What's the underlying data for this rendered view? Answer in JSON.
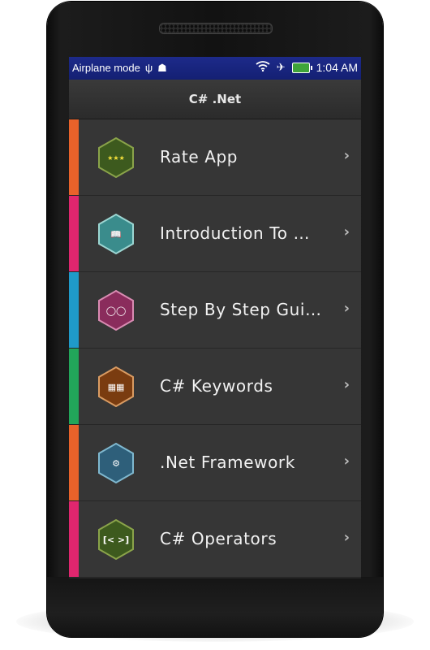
{
  "status_bar": {
    "left_text": "Airplane mode",
    "usb_icon": "usb-icon",
    "android_icon": "android-icon",
    "wifi_icon": "wifi-icon",
    "airplane_icon": "airplane-icon",
    "battery_icon": "battery-charging-icon",
    "time": "1:04 AM"
  },
  "app_bar": {
    "title": "C# .Net"
  },
  "menu": [
    {
      "label": "Rate App",
      "stripe_color": "#e8622a",
      "icon": "stars-icon",
      "icon_symbol": "★★★",
      "hex_color": "#3d5a1e",
      "hex_border": "#8aa34a"
    },
    {
      "label": "Introduction To …",
      "stripe_color": "#e0266e",
      "icon": "book-icon",
      "icon_symbol": "📖",
      "hex_color": "#3a8c8c",
      "hex_border": "#9cd6d2"
    },
    {
      "label": "Step By Step Gui…",
      "stripe_color": "#1f9ac9",
      "icon": "glasses-icon",
      "icon_symbol": "◯◯",
      "hex_color": "#8a2c5c",
      "hex_border": "#d98bb2"
    },
    {
      "label": "C# Keywords",
      "stripe_color": "#22a65a",
      "icon": "scrabble-tiles-icon",
      "icon_symbol": "▦▦",
      "hex_color": "#7a3c10",
      "hex_border": "#d99b62"
    },
    {
      "label": ".Net Framework",
      "stripe_color": "#e8622a",
      "icon": "window-settings-icon",
      "icon_symbol": "⚙",
      "hex_color": "#2e5f7a",
      "hex_border": "#7fb8cf"
    },
    {
      "label": "C# Operators",
      "stripe_color": "#e0266e",
      "icon": "code-brackets-icon",
      "icon_symbol": "[< >]",
      "hex_color": "#3d5a1e",
      "hex_border": "#8aa34a"
    }
  ],
  "chevron_glyph": "›"
}
